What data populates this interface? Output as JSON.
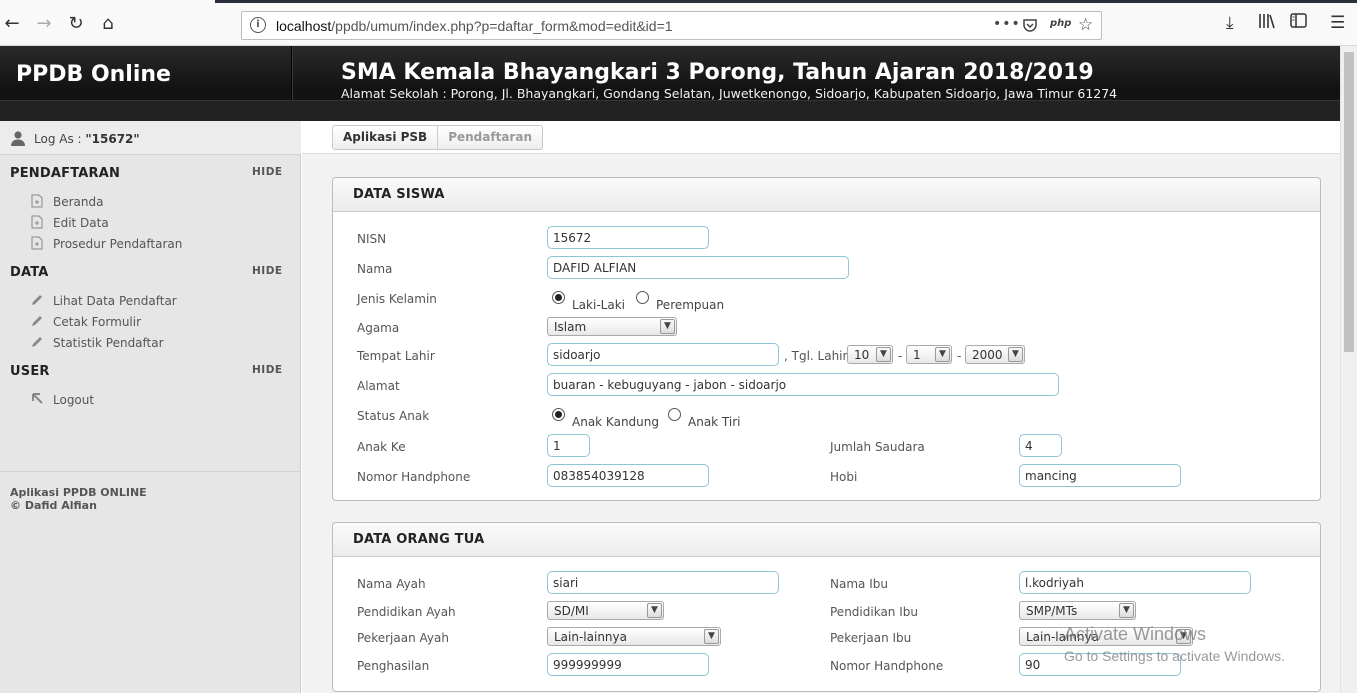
{
  "browser": {
    "url_host": "localhost",
    "url_path": "/ppdb/umum/index.php?p=daftar_form&mod=edit&id=1",
    "more_label": "•••",
    "php_label": "php"
  },
  "header": {
    "brand": "PPDB Online",
    "school": "SMA Kemala Bhayangkari 3 Porong, Tahun Ajaran 2018/2019",
    "address": "Alamat Sekolah : Porong, Jl. Bhayangkari, Gondang Selatan, Juwetkenongo, Sidoarjo, Kabupaten Sidoarjo, Jawa Timur 61274"
  },
  "sidebar": {
    "login_prefix": "Log As : ",
    "login_user": "\"15672\"",
    "hide_label": "HIDE",
    "sections": [
      {
        "title": "PENDAFTARAN",
        "items": [
          "Beranda",
          "Edit Data",
          "Prosedur Pendaftaran"
        ]
      },
      {
        "title": "DATA",
        "items": [
          "Lihat Data Pendaftar",
          "Cetak Formulir",
          "Statistik Pendaftar"
        ]
      },
      {
        "title": "USER",
        "items": [
          "Logout"
        ]
      }
    ],
    "footer_line1": "Aplikasi PPDB ONLINE",
    "footer_line2": "© Dafid Alfian"
  },
  "breadcrumb": {
    "root": "Aplikasi PSB",
    "current": "Pendaftaran"
  },
  "siswa": {
    "title": "DATA SISWA",
    "nisn_label": "NISN",
    "nisn": "15672",
    "nama_label": "Nama",
    "nama": "DAFID ALFIAN",
    "jk_label": "Jenis Kelamin",
    "jk_options": [
      "Laki-Laki",
      "Perempuan"
    ],
    "agama_label": "Agama",
    "agama": "Islam",
    "tempat_label": "Tempat Lahir",
    "tempat": "sidoarjo",
    "tgl_label": ", Tgl. Lahir",
    "tgl_day": "10",
    "tgl_month": "1",
    "tgl_year": "2000",
    "dash": "-",
    "alamat_label": "Alamat",
    "alamat": "buaran - kebuguyang - jabon - sidoarjo",
    "status_label": "Status Anak",
    "status_options": [
      "Anak Kandung",
      "Anak Tiri"
    ],
    "anakke_label": "Anak Ke",
    "anakke": "1",
    "saudara_label": "Jumlah Saudara",
    "saudara": "4",
    "hp_label": "Nomor Handphone",
    "hp": "083854039128",
    "hobi_label": "Hobi",
    "hobi": "mancing"
  },
  "ortu": {
    "title": "DATA ORANG TUA",
    "ayah_label": "Nama Ayah",
    "ayah": "siari",
    "ibu_label": "Nama Ibu",
    "ibu": "l.kodriyah",
    "pend_ayah_label": "Pendidikan Ayah",
    "pend_ayah": "SD/MI",
    "pend_ibu_label": "Pendidikan Ibu",
    "pend_ibu": "SMP/MTs",
    "kerja_ayah_label": "Pekerjaan Ayah",
    "kerja_ayah": "Lain-lainnya",
    "kerja_ibu_label": "Pekerjaan Ibu",
    "kerja_ibu": "Lain-lainnya",
    "hasil_label": "Penghasilan",
    "hasil": "999999999",
    "hp_label": "Nomor Handphone",
    "hp": "90"
  },
  "watermark": {
    "line1": "Activate Windows",
    "line2": "Go to Settings to activate Windows."
  }
}
